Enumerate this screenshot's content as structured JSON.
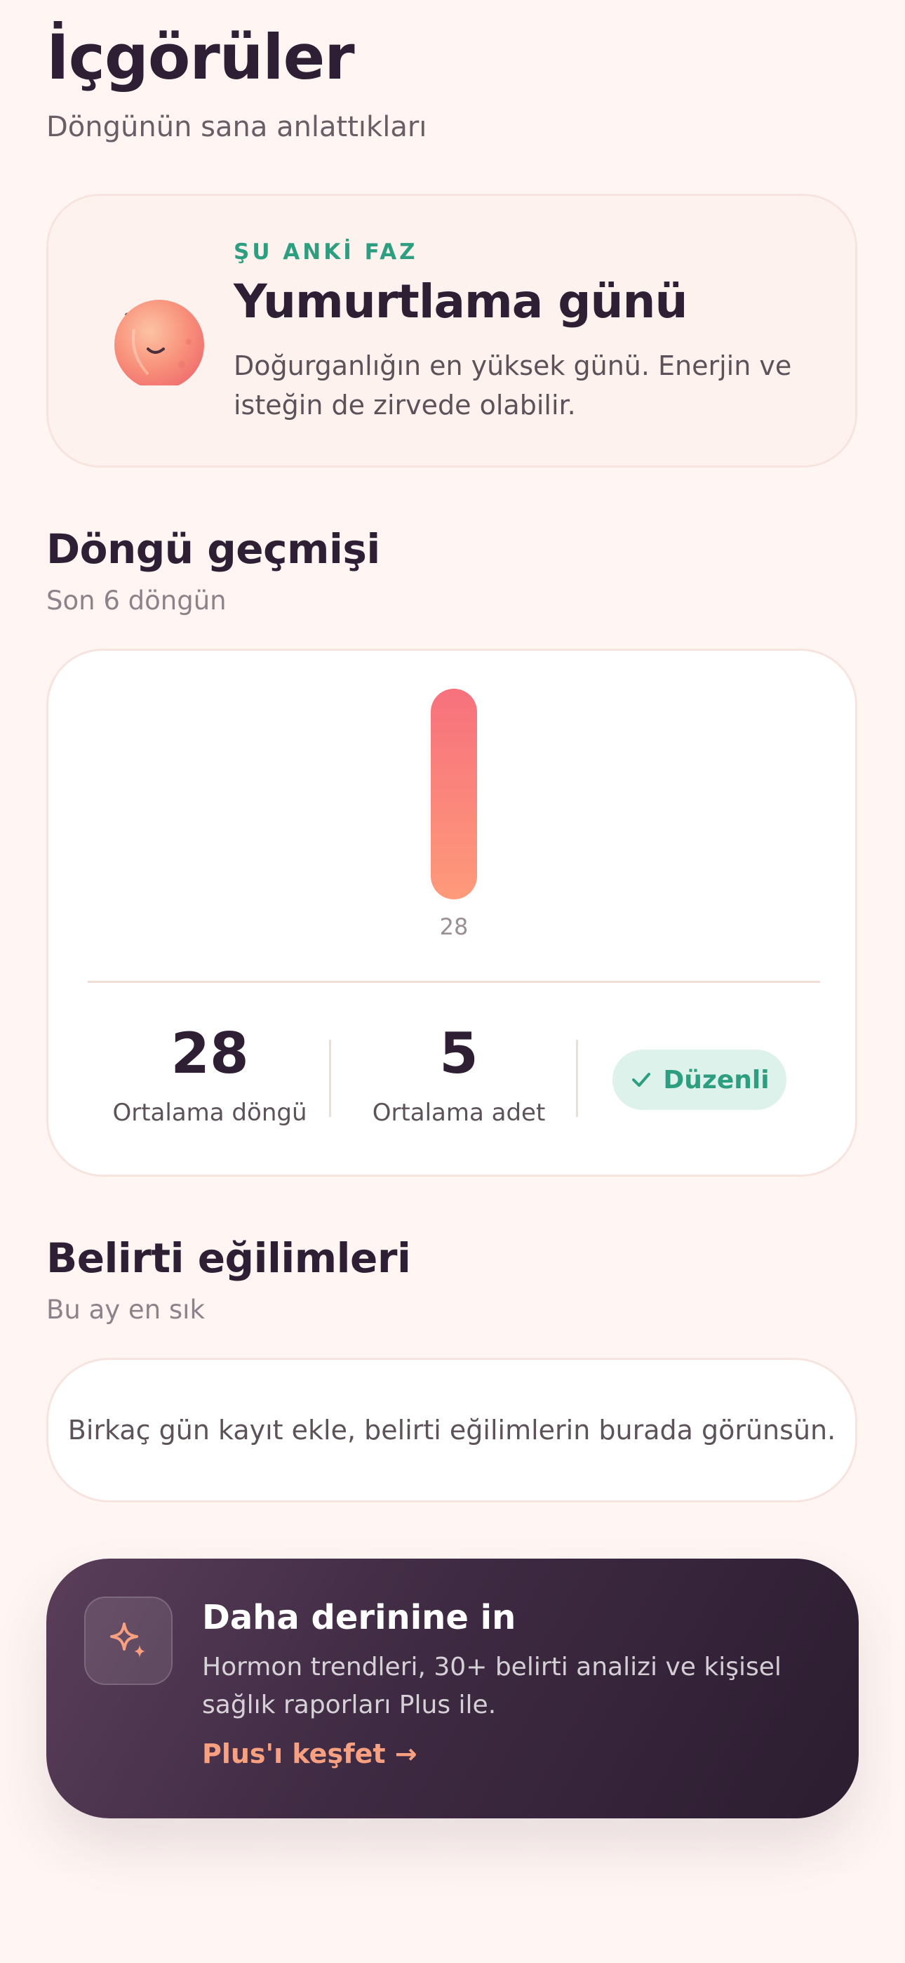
{
  "header": {
    "title": "İçgörüler",
    "subtitle": "Döngünün sana anlattıkları"
  },
  "phase": {
    "label": "ŞU ANKİ FAZ",
    "title": "Yumurtlama günü",
    "description": "Doğurganlığın en yüksek günü. Enerjin ve isteğin de zirvede olabilir.",
    "icon": "sleeping-moon-icon"
  },
  "history": {
    "title": "Döngü geçmişi",
    "subtitle": "Son 6 döngün",
    "stats": {
      "avg_cycle_value": "28",
      "avg_cycle_label": "Ortalama döngü",
      "avg_period_value": "5",
      "avg_period_label": "Ortalama adet",
      "badge_label": "Düzenli"
    }
  },
  "chart_data": {
    "type": "bar",
    "categories": [
      "28"
    ],
    "values": [
      28
    ],
    "title": "",
    "xlabel": "",
    "ylabel": "",
    "colors": {
      "bar_top": "#F7717D",
      "bar_bottom": "#FE9A7A",
      "tick_label": "#9B8F95"
    }
  },
  "symptoms": {
    "title": "Belirti eğilimleri",
    "subtitle": "Bu ay en sık",
    "empty_message": "Birkaç gün kayıt ekle, belirti eğilimlerin burada görünsün."
  },
  "plus": {
    "title": "Daha derinine in",
    "description": "Hormon trendleri, 30+ belirti analizi ve kişisel sağlık raporları Plus ile.",
    "link_label": "Plus'ı keşfet →",
    "icon": "sparkle-icon"
  },
  "colors": {
    "background": "#FFF6F3",
    "accent_green": "#2E9E80",
    "accent_coral": "#F8A07F",
    "dark": "#2E1F35"
  }
}
